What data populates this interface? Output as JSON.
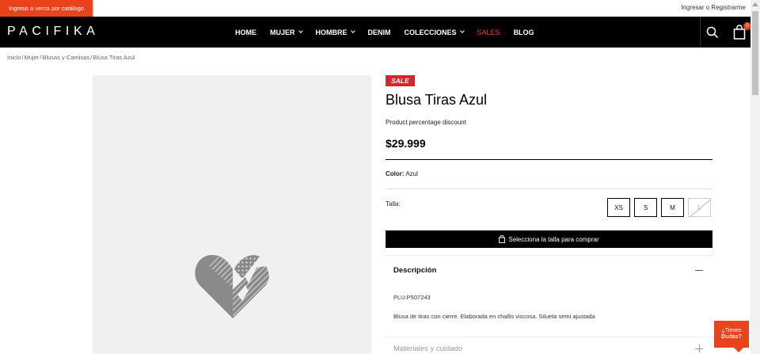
{
  "topbar": {
    "catalog_label": "Ingreso a venta por catálogo",
    "login_label": "Ingresar o Registrarme"
  },
  "header": {
    "logo": "PACIFIKA",
    "nav": [
      {
        "label": "HOME",
        "dropdown": false
      },
      {
        "label": "MUJER",
        "dropdown": true
      },
      {
        "label": "HOMBRE",
        "dropdown": true
      },
      {
        "label": "DENIM",
        "dropdown": false
      },
      {
        "label": "COLECCIONES",
        "dropdown": true
      },
      {
        "label": "SALES",
        "dropdown": false
      },
      {
        "label": "BLOG",
        "dropdown": false
      }
    ],
    "cart_count": "0"
  },
  "breadcrumb": [
    "Inicio",
    "Mujer",
    "Blusas y Camisas",
    "Blusa Tiras Azul"
  ],
  "product": {
    "badge": "SALE",
    "title": "Blusa Tiras Azul",
    "promo_text": "Product percentage discount",
    "price": "$29.999",
    "color_label": "Color:",
    "color_value": "Azul",
    "size_label": "Talla:",
    "sizes": [
      {
        "label": "XS",
        "available": true
      },
      {
        "label": "S",
        "available": true
      },
      {
        "label": "M",
        "available": true
      },
      {
        "label": "L",
        "available": false
      }
    ],
    "buy_button": "Selecciona la talla para comprar"
  },
  "description": {
    "heading": "Descripción",
    "plu": "PLU:P507243",
    "text": "Blusa de tiras con cierre. Elaborada en challis viscosa. Silueta semi ajustada",
    "materials_heading": "Materiales y cuidado"
  },
  "help": {
    "line1": "¿Tienes",
    "line2": "Dudas?"
  },
  "colors": {
    "accent": "#e8431b",
    "sale": "#d9242b",
    "header_bg": "#000000"
  }
}
